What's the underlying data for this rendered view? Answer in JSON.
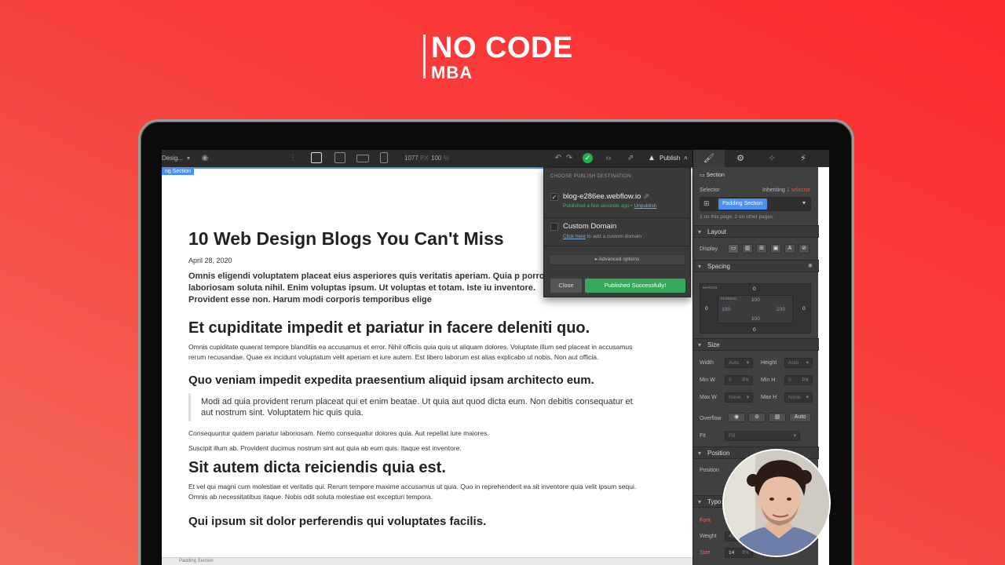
{
  "brand": {
    "line1": "NO CODE",
    "line2": "MBA"
  },
  "toolbar": {
    "page_label": "Desig...",
    "width_value": "1077",
    "width_unit": "PX",
    "zoom_value": "100",
    "zoom_unit": "%",
    "publish_label": "Publish"
  },
  "canvas": {
    "selection_tag": "ng Section",
    "bottom_breadcrumb": "Padding Section"
  },
  "article": {
    "title": "10 Web Design Blogs You Can't Miss",
    "date": "April 28, 2020",
    "lead": "Omnis eligendi voluptatem placeat eius asperiores quis veritatis aperiam. Quia p porro laboriosam soluta nihil. Enim voluptas ipsum. Ut voluptas et totam. Iste iu inventore. Provident esse non. Harum modi corporis temporibus elige",
    "h2_1": "Et cupiditate impedit et pariatur in facere deleniti quo.",
    "p1": "Omnis cupiditate quaerat tempore blanditiis ea accusamus et error. Nihil officiis quia quis ut aliquam dolores. Voluptate illum sed placeat in accusamus rerum recusandae. Quae ex incidunt voluptatum velit aperiam et iure autem. Est libero laborum est alias explicabo ut nobis. Non aut officia.",
    "h3_1": "Quo veniam impedit expedita praesentium aliquid ipsam architecto eum.",
    "quote": "Modi ad quia provident rerum placeat qui et enim beatae. Ut quia aut quod dicta eum. Non debitis consequatur et aut nostrum sint. Voluptatem hic quis quia.",
    "p2": "Consequuntur quidem pariatur laboriosam. Nemo consequatur dolores quia. Aut repellat iure maiores.",
    "p3": "Suscipit illum ab. Provident ducimus nostrum sint aut quia ab eum quis. Itaque est inventore.",
    "h2_2": "Sit autem dicta reiciendis quia est.",
    "p4": "Et vel qui magni cum molestiae et veritatis qui. Rerum tempore maxime accusamus ut quia. Quo in reprehenderit ea sit inventore quia velit ipsum sequi. Omnis ab necessitatibus itaque. Nobis odit soluta molestiae est excepturi tempora.",
    "h3_2": "Qui ipsum sit dolor perferendis qui voluptates facilis."
  },
  "publish_popup": {
    "heading": "CHOOSE PUBLISH DESTINATION:",
    "domain1": "blog-e286ee.webflow.io",
    "domain1_status": "Published a few seconds ago",
    "domain1_unpublish": "Unpublish",
    "domain2": "Custom Domain",
    "domain2_link": "Click here",
    "domain2_rest": " to add a custom domain",
    "advanced": "Advanced options",
    "close": "Close",
    "success": "Published Successfully!"
  },
  "style_panel": {
    "element_label": "Section",
    "selector_label": "Selector",
    "inheriting": "Inheriting",
    "inheriting_count": "1 selector",
    "selector_chip": "Padding Section",
    "usage_note": "1 on this page, 2 on other pages.",
    "layout_title": "Layout",
    "display_label": "Display",
    "spacing_title": "Spacing",
    "margin_label": "MARGIN",
    "padding_label": "PADDING",
    "margin_top": "0",
    "margin_left": "0",
    "margin_right": "0",
    "margin_bottom": "0",
    "padding_top": "100",
    "padding_left": "100",
    "padding_right": "100",
    "padding_bottom": "100",
    "size_title": "Size",
    "width_label": "Width",
    "width_value": "Auto",
    "height_label": "Height",
    "height_value": "Auto",
    "minw_label": "Min W",
    "minw_value": "0",
    "minw_unit": "PX",
    "minh_label": "Min H",
    "minh_value": "0",
    "minh_unit": "PX",
    "maxw_label": "Max W",
    "maxw_value": "None",
    "maxh_label": "Max H",
    "maxh_value": "None",
    "overflow_label": "Overflow",
    "overflow_auto": "Auto",
    "fit_label": "Fit",
    "fit_value": "Fill",
    "position_title": "Position",
    "position_label": "Position",
    "typo_title": "Typo",
    "font_label": "Font",
    "weight_label": "Weight",
    "weight_value": "40",
    "size_label": "Size",
    "size_value": "14",
    "size_unit": "PX",
    "height2_label": "Height",
    "height2_value": "20"
  },
  "colors": {
    "brand_red": "#ff2a2e",
    "selection_blue": "#4a8ff5",
    "success_green": "#37a85a"
  }
}
